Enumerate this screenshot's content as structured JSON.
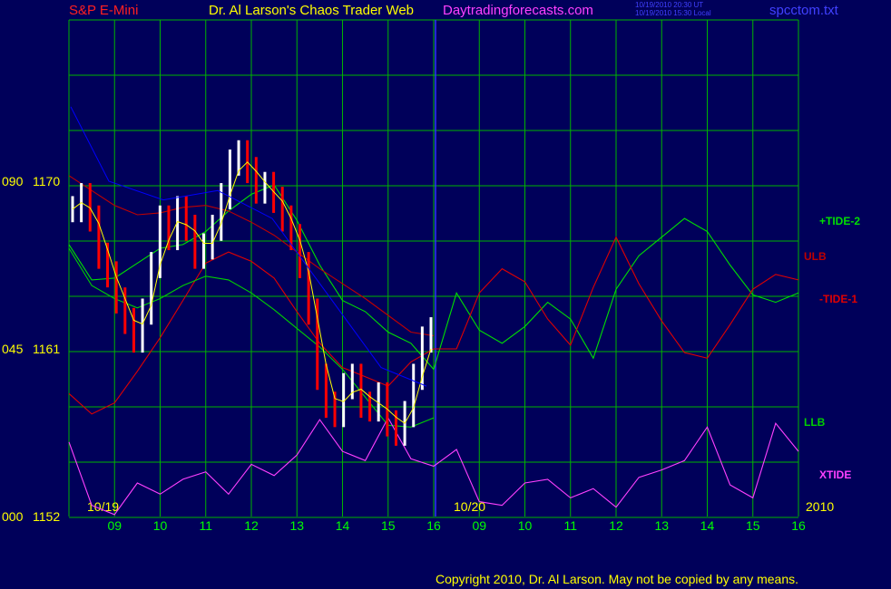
{
  "header": {
    "instrument": "S&P E-Mini",
    "title": "Dr. Al Larson's Chaos Trader Web",
    "site": "Daytradingforecasts.com",
    "timestamp_ut": "10/19/2010 20:30 UT",
    "timestamp_local": "10/19/2010 15:30 Local",
    "filename": "spcctom.txt"
  },
  "footer": {
    "copyright": "Copyright 2010, Dr. Al Larson. May not be copied by any means."
  },
  "colors": {
    "background": "#00005a",
    "grid": "#00b400",
    "price_up": "#ffffff",
    "price_down": "#ff0000",
    "tide2": "#00e000",
    "tide1": "#e00000",
    "ulb": "#c00000",
    "llb": "#00d000",
    "xtide": "#ff40ff",
    "yellow_ma": "#ffff00",
    "blue_ma": "#0000ff",
    "divider": "#3030ff"
  },
  "chart_data": {
    "type": "line",
    "y_axis": {
      "ticks": [
        {
          "index": "090",
          "price": "1170"
        },
        {
          "index": "045",
          "price": "1161"
        },
        {
          "index": "000",
          "price": "1152"
        }
      ],
      "ylim": [
        1152,
        1170
      ]
    },
    "x_axis": {
      "day_labels": [
        "10/19",
        "10/20"
      ],
      "year_label": "2010",
      "hour_ticks": [
        "09",
        "10",
        "11",
        "12",
        "13",
        "14",
        "15",
        "16",
        "09",
        "10",
        "11",
        "12",
        "13",
        "14",
        "15",
        "16"
      ]
    },
    "series": [
      {
        "name": "+TIDE-2",
        "x": [
          0,
          0.5,
          1,
          1.5,
          2,
          2.5,
          3,
          3.5,
          4,
          4.5,
          5,
          5.5,
          6,
          6.5,
          7,
          7.5,
          8,
          8.5,
          9,
          9.5,
          10,
          10.5,
          11,
          11.5,
          12,
          12.5,
          13,
          13.5,
          14,
          14.5,
          15,
          15.5,
          16
        ],
        "y": [
          1166.6,
          1164.7,
          1164.8,
          1165.6,
          1166.4,
          1166.6,
          1167.3,
          1168.4,
          1169.3,
          1169.8,
          1167.9,
          1165.5,
          1163.6,
          1163.0,
          1161.9,
          1161.3,
          1159.9,
          1164.0,
          1162.0,
          1161.3,
          1162.2,
          1163.5,
          1162.6,
          1160.5,
          1164.2,
          1166.0,
          1167.0,
          1168.0,
          1167.3,
          1165.5,
          1163.9,
          1163.5,
          1164.0
        ]
      },
      {
        "name": "-TIDE-1",
        "x": [
          0,
          0.5,
          1,
          1.5,
          2,
          2.5,
          3,
          3.5,
          4,
          4.5,
          5,
          5.5,
          6,
          6.5,
          7,
          7.5,
          8,
          8.5,
          9,
          9.5,
          10,
          10.5,
          11,
          11.5,
          12,
          12.5,
          13,
          13.5,
          14,
          14.5,
          15,
          15.5,
          16
        ],
        "y": [
          1158.6,
          1157.5,
          1158.1,
          1159.8,
          1161.6,
          1163.6,
          1165.6,
          1166.2,
          1165.7,
          1164.8,
          1163.0,
          1161.3,
          1160.0,
          1159.5,
          1159.0,
          1160.3,
          1161.0,
          1161.0,
          1164.0,
          1165.3,
          1164.6,
          1162.6,
          1161.2,
          1164.3,
          1167.0,
          1164.5,
          1162.5,
          1160.8,
          1160.5,
          1162.3,
          1164.2,
          1165.0,
          1164.7
        ]
      },
      {
        "name": "ULB",
        "x": [
          0,
          0.5,
          1,
          1.5,
          2,
          2.5,
          3,
          3.5,
          4,
          4.5,
          5,
          5.5,
          6,
          6.5,
          7,
          7.5,
          8
        ],
        "y": [
          1170.3,
          1169.5,
          1168.7,
          1168.2,
          1168.3,
          1168.6,
          1168.7,
          1168.4,
          1167.8,
          1167.1,
          1166.2,
          1165.3,
          1164.5,
          1163.7,
          1162.8,
          1161.9,
          1161.7
        ]
      },
      {
        "name": "LLB",
        "x": [
          0,
          0.5,
          1,
          1.5,
          2,
          2.5,
          3,
          3.5,
          4,
          4.5,
          5,
          5.5,
          6,
          6.5,
          7,
          7.5,
          8
        ],
        "y": [
          1166.4,
          1164.4,
          1163.7,
          1163.2,
          1163.7,
          1164.4,
          1164.9,
          1164.7,
          1164.0,
          1163.1,
          1162.1,
          1161.1,
          1159.9,
          1158.4,
          1156.9,
          1156.8,
          1157.3
        ]
      },
      {
        "name": "XTIDE",
        "x": [
          0,
          0.5,
          1,
          1.5,
          2,
          2.5,
          3,
          3.5,
          4,
          4.5,
          5,
          5.5,
          6,
          6.5,
          7,
          7.5,
          8,
          8.5,
          9,
          9.5,
          10,
          10.5,
          11,
          11.5,
          12,
          12.5,
          13,
          13.5,
          14,
          14.5,
          15,
          15.5,
          16
        ],
        "y": [
          1156.0,
          1152.6,
          1152.1,
          1153.8,
          1153.2,
          1154.0,
          1154.4,
          1153.2,
          1154.8,
          1154.2,
          1155.3,
          1157.2,
          1155.5,
          1155.0,
          1157.3,
          1155.1,
          1154.7,
          1155.6,
          1152.8,
          1152.6,
          1153.8,
          1154.0,
          1153.0,
          1153.5,
          1152.5,
          1154.1,
          1154.5,
          1155.0,
          1156.8,
          1153.7,
          1153.0,
          1157.0,
          1155.5
        ]
      }
    ],
    "legend": [
      "+TIDE-2",
      "ULB",
      "-TIDE-1",
      "LLB",
      "XTIDE"
    ],
    "grid": true
  }
}
